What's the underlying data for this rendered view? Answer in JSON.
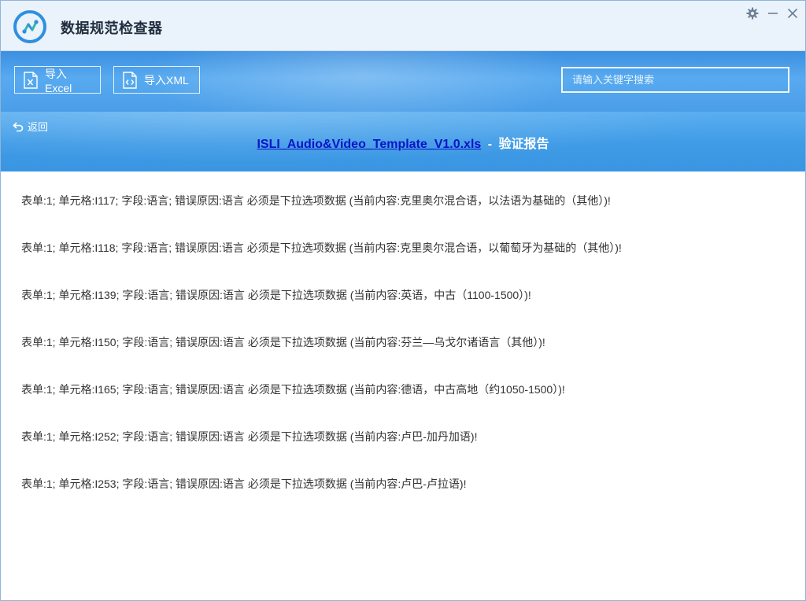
{
  "app": {
    "title": "数据规范检查器"
  },
  "window_controls": {
    "settings_icon": "gear-icon",
    "minimize_icon": "minimize-icon",
    "close_icon": "close-icon"
  },
  "toolbar": {
    "import_excel_label": "导入Excel",
    "import_xml_label": "导入XML",
    "search_placeholder": "请输入关键字搜索",
    "search_value": ""
  },
  "report": {
    "back_label": "返回",
    "file_name": "ISLI_Audio&Video_Template_V1.0.xls",
    "separator": "-",
    "title_suffix": "验证报告"
  },
  "errors": [
    "表单:1;  单元格:I117;  字段:语言;   错误原因:语言 必须是下拉选项数据 (当前内容:克里奥尔混合语，以法语为基础的（其他）)!",
    "表单:1;  单元格:I118;  字段:语言;   错误原因:语言 必须是下拉选项数据 (当前内容:克里奥尔混合语，以葡萄牙为基础的（其他）)!",
    "表单:1;  单元格:I139;  字段:语言;   错误原因:语言 必须是下拉选项数据 (当前内容:英语，中古（1100-1500）)!",
    "表单:1;  单元格:I150;  字段:语言;   错误原因:语言 必须是下拉选项数据 (当前内容:芬兰—乌戈尔诸语言（其他）)!",
    "表单:1;  单元格:I165;  字段:语言;   错误原因:语言 必须是下拉选项数据 (当前内容:德语，中古高地（约1050-1500）)!",
    "表单:1;  单元格:I252;  字段:语言;   错误原因:语言 必须是下拉选项数据 (当前内容:卢巴-加丹加语)!",
    "表单:1;  单元格:I253;  字段:语言;   错误原因:语言 必须是下拉选项数据 (当前内容:卢巴-卢拉语)!"
  ],
  "colors": {
    "toolbar_blue": "#4a9ee8",
    "link_blue": "#0a14c8",
    "text": "#333333"
  }
}
